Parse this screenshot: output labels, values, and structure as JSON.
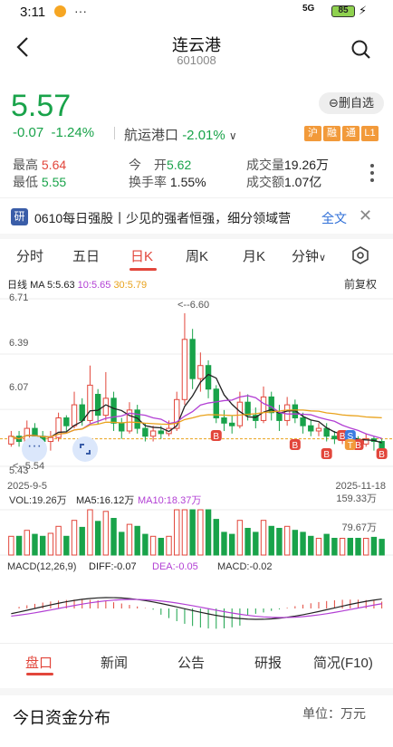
{
  "status": {
    "time": "3:11",
    "dots": "···",
    "network": "5G",
    "battery": "85"
  },
  "header": {
    "title": "连云港",
    "code": "601008"
  },
  "quote": {
    "price": "5.57",
    "change": "-0.07",
    "change_pct": "-1.24%",
    "sector": "航运港口",
    "sector_pct": "-2.01%",
    "delete_label": "删自选",
    "tags": [
      "沪",
      "融",
      "通",
      "L1"
    ]
  },
  "stats": {
    "high_label": "最高",
    "high": "5.64",
    "low_label": "最低",
    "low": "5.55",
    "open_label": "今　开",
    "open": "5.62",
    "turnover_label": "换手率",
    "turnover": "1.55%",
    "volume_label": "成交量",
    "volume": "19.26万",
    "amount_label": "成交额",
    "amount": "1.07亿"
  },
  "news": {
    "badge": "研",
    "text": "0610每日强股丨少见的强者恒强，细分领域营",
    "full_label": "全文"
  },
  "tabs": [
    "分时",
    "五日",
    "日K",
    "周K",
    "月K",
    "分钟"
  ],
  "chart_legend": {
    "line": "日线",
    "ma5": "MA 5:5.63",
    "ma10": "10:5.65",
    "ma30": "30:5.79",
    "fuquan": "前复权"
  },
  "chart_labels": {
    "y_top": "6.71",
    "y_2": "6.39",
    "y_3": "6.07",
    "y_bottom": "5.43",
    "high_annot": "<--6.60",
    "low_annot": "<--5.54",
    "date_start": "2025-9-5",
    "date_end": "2025-11-18",
    "vol": "VOL:19.26万",
    "vol_ma5": "MA5:16.12万",
    "vol_ma10": "MA10:18.37万",
    "vol_max": "159.33万",
    "vol_mid": "79.67万",
    "macd": "MACD(12,26,9)",
    "diff": "DIFF:-0.07",
    "dea": "DEA:-0.05",
    "macd_val": "MACD:-0.02"
  },
  "colors": {
    "up": "#e2463b",
    "down": "#19a34a",
    "ma5": "#222222",
    "ma10": "#b23fd4",
    "ma30": "#e9a21b"
  },
  "chart_data": {
    "type": "candlestick",
    "ylim": [
      5.43,
      6.71
    ],
    "candles": [
      [
        5.6,
        5.66,
        5.58,
        5.7
      ],
      [
        5.66,
        5.62,
        5.58,
        5.7
      ],
      [
        5.62,
        5.72,
        5.6,
        5.78
      ],
      [
        5.72,
        5.66,
        5.62,
        5.76
      ],
      [
        5.66,
        5.62,
        5.58,
        5.7
      ],
      [
        5.62,
        5.65,
        5.55,
        5.7
      ],
      [
        5.65,
        5.8,
        5.62,
        5.84
      ],
      [
        5.8,
        5.74,
        5.7,
        5.82
      ],
      [
        5.74,
        5.9,
        5.72,
        6.0
      ],
      [
        5.9,
        5.78,
        5.74,
        5.95
      ],
      [
        5.78,
        6.05,
        5.76,
        6.2
      ],
      [
        5.98,
        5.82,
        5.75,
        6.02
      ],
      [
        5.82,
        5.95,
        5.78,
        6.15
      ],
      [
        5.95,
        5.76,
        5.7,
        6.0
      ],
      [
        5.76,
        5.7,
        5.64,
        5.8
      ],
      [
        5.7,
        5.86,
        5.68,
        5.92
      ],
      [
        5.86,
        5.72,
        5.68,
        5.9
      ],
      [
        5.72,
        5.66,
        5.62,
        5.76
      ],
      [
        5.66,
        5.7,
        5.62,
        5.74
      ],
      [
        5.7,
        5.68,
        5.64,
        5.74
      ],
      [
        5.68,
        5.72,
        5.66,
        5.78
      ],
      [
        5.72,
        5.94,
        5.7,
        6.0
      ],
      [
        5.94,
        6.4,
        5.9,
        6.6
      ],
      [
        6.4,
        6.1,
        6.02,
        6.48
      ],
      [
        6.1,
        6.2,
        6.0,
        6.3
      ],
      [
        6.2,
        6.02,
        5.95,
        6.24
      ],
      [
        6.02,
        5.8,
        5.76,
        6.05
      ],
      [
        5.8,
        5.76,
        5.7,
        5.86
      ],
      [
        5.76,
        5.74,
        5.68,
        5.82
      ],
      [
        5.74,
        5.92,
        5.72,
        6.0
      ],
      [
        5.92,
        5.82,
        5.78,
        5.98
      ],
      [
        5.82,
        5.78,
        5.72,
        5.88
      ],
      [
        5.78,
        5.96,
        5.76,
        6.04
      ],
      [
        5.96,
        5.84,
        5.78,
        6.0
      ],
      [
        5.84,
        5.78,
        5.7,
        5.9
      ],
      [
        5.78,
        5.9,
        5.74,
        5.96
      ],
      [
        5.9,
        5.8,
        5.76,
        5.94
      ],
      [
        5.8,
        5.74,
        5.68,
        5.84
      ],
      [
        5.74,
        5.7,
        5.66,
        5.78
      ],
      [
        5.7,
        5.72,
        5.66,
        5.76
      ],
      [
        5.72,
        5.66,
        5.62,
        5.76
      ],
      [
        5.66,
        5.64,
        5.6,
        5.7
      ],
      [
        5.64,
        5.66,
        5.6,
        5.7
      ],
      [
        5.66,
        5.62,
        5.58,
        5.68
      ],
      [
        5.62,
        5.6,
        5.56,
        5.66
      ],
      [
        5.6,
        5.64,
        5.58,
        5.68
      ],
      [
        5.64,
        5.62,
        5.55,
        5.66
      ],
      [
        5.62,
        5.57,
        5.55,
        5.64
      ]
    ],
    "ma_levels": {
      "ma5": 5.63,
      "ma10": 5.65,
      "ma30": 5.79
    }
  }
}
